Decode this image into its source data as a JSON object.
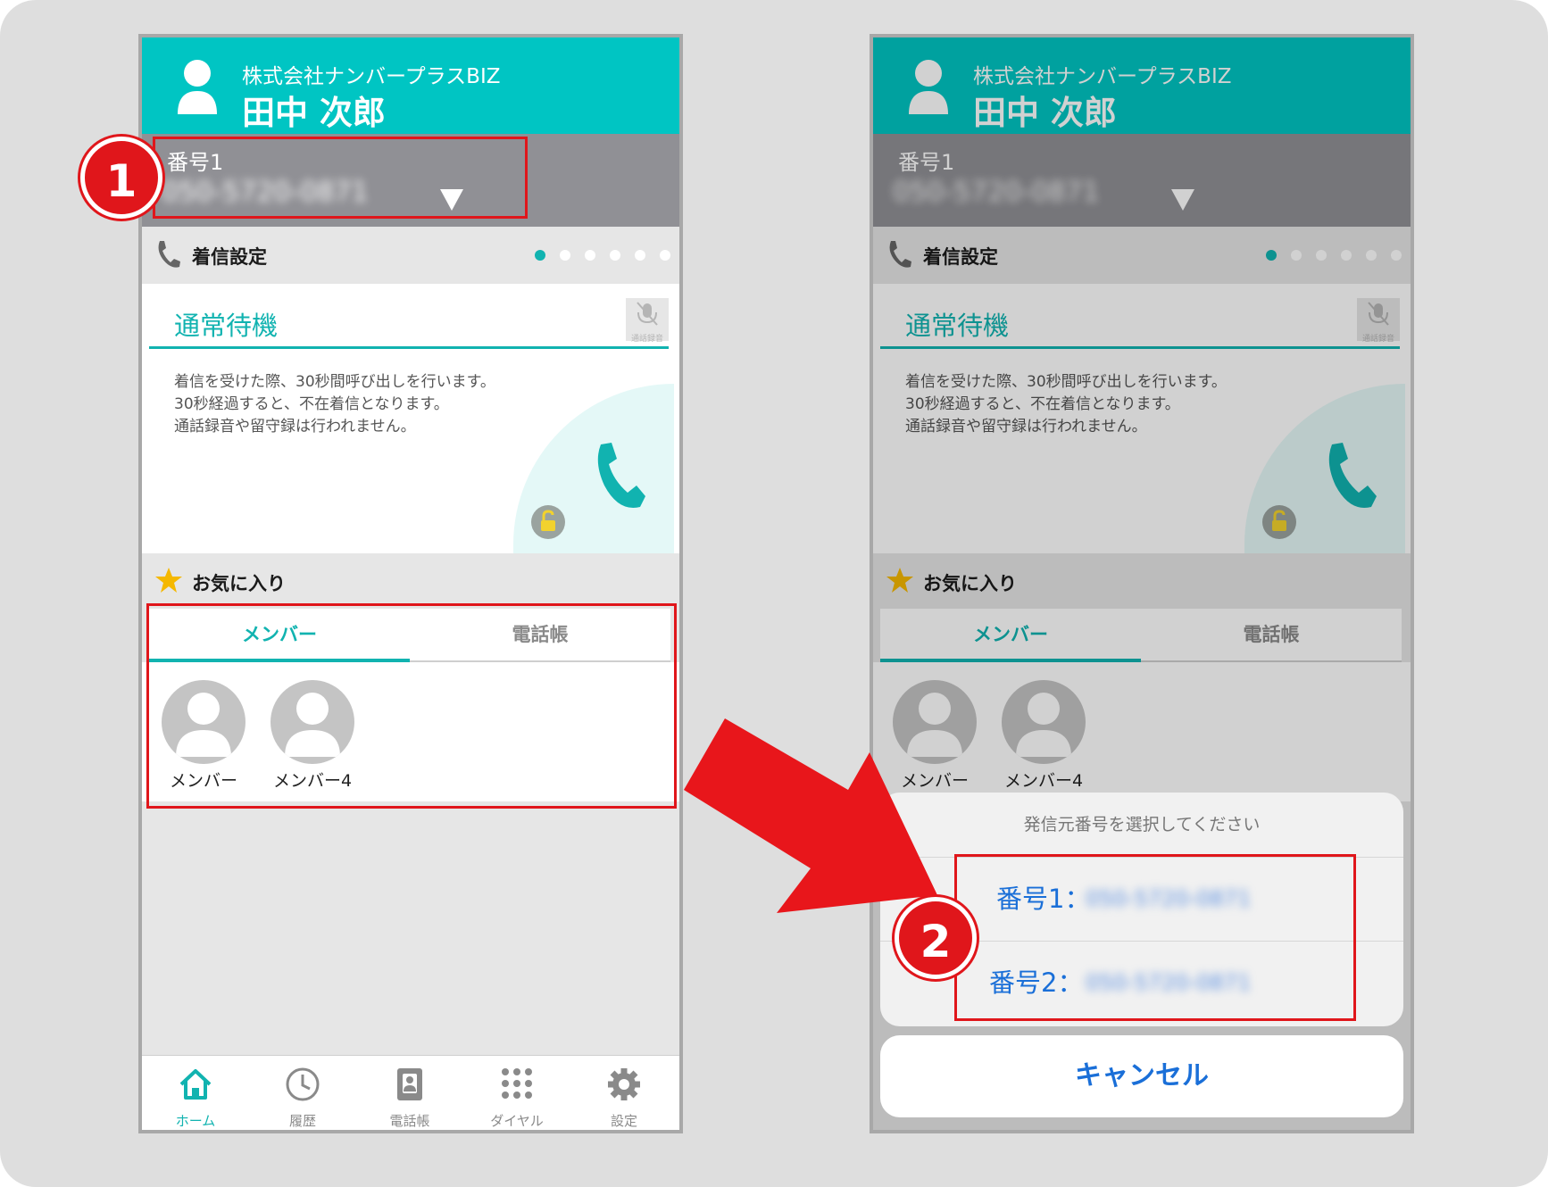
{
  "header": {
    "company": "株式会社ナンバープラスBIZ",
    "user_name": "田中 次郎"
  },
  "number_selector": {
    "label": "番号1",
    "value": "050-5720-0871"
  },
  "incoming": {
    "section_title": "着信設定",
    "page_count": 6,
    "active_page": 0
  },
  "mode": {
    "title": "通常待機",
    "record_label": "通話録音",
    "desc_lines": [
      "着信を受けた際、30秒間呼び出しを行います。",
      "30秒経過すると、不在着信となります。",
      "通話録音や留守録は行われません。"
    ]
  },
  "favorites": {
    "section_title": "お気に入り",
    "tabs": [
      {
        "label": "メンバー",
        "active": true
      },
      {
        "label": "電話帳",
        "active": false
      }
    ],
    "members": [
      {
        "name": "メンバー"
      },
      {
        "name": "メンバー4"
      }
    ]
  },
  "nav": [
    {
      "label": "ホーム",
      "icon": "home-icon",
      "active": true
    },
    {
      "label": "履歴",
      "icon": "history-icon",
      "active": false
    },
    {
      "label": "電話帳",
      "icon": "phonebook-icon",
      "active": false
    },
    {
      "label": "ダイヤル",
      "icon": "dialpad-icon",
      "active": false
    },
    {
      "label": "設定",
      "icon": "gear-icon",
      "active": false
    }
  ],
  "sheet": {
    "title": "発信元番号を選択してください",
    "options": [
      {
        "label": "番号1：",
        "value": "050-5720-0871"
      },
      {
        "label": "番号2：",
        "value": "050-5720-0871"
      }
    ],
    "cancel_label": "キャンセル"
  },
  "callouts": {
    "step1": "1",
    "step2": "2"
  },
  "colors": {
    "accent": "#11b3b0",
    "header": "#00c5c3",
    "highlight": "#e0161b",
    "link": "#1a6fd8"
  }
}
